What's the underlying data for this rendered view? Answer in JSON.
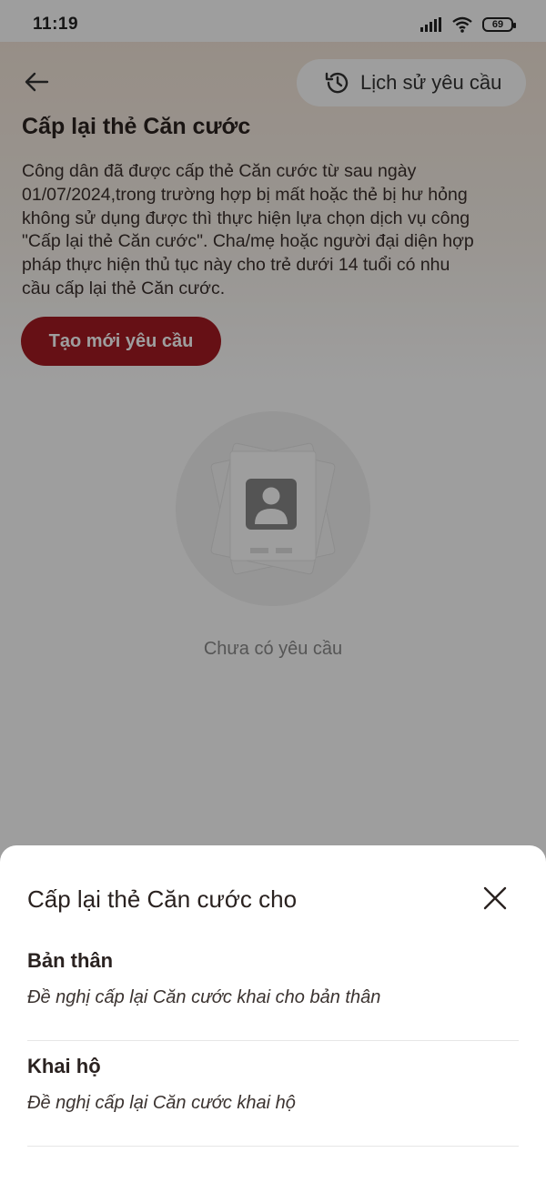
{
  "status_bar": {
    "time": "11:19",
    "battery": "69"
  },
  "header": {
    "history_label": "Lịch sử yêu cầu"
  },
  "page": {
    "title": "Cấp lại thẻ Căn cước",
    "description_lines": [
      "Công dân đã được cấp thẻ Căn cước từ sau ngày",
      "01/07/2024,trong trường hợp bị mất hoặc thẻ bị hư hỏng",
      "không sử dụng được thì thực hiện lựa chọn dịch vụ công",
      "\"Cấp lại thẻ Căn cước\". Cha/mẹ hoặc người đại diện hợp",
      "pháp thực hiện thủ tục này cho trẻ dưới 14 tuổi có nhu",
      "cầu cấp lại thẻ Căn cước."
    ],
    "create_button_label": "Tạo mới yêu cầu",
    "empty_text": "Chưa có yêu cầu"
  },
  "sheet": {
    "title": "Cấp lại thẻ Căn cước cho",
    "options": [
      {
        "title": "Bản thân",
        "description": "Đề nghị cấp lại Căn cước khai cho bản thân"
      },
      {
        "title": "Khai hộ",
        "description": "Đề nghị cấp lại Căn cước khai hộ"
      }
    ]
  },
  "colors": {
    "primary": "#a51b22",
    "overlay": "rgba(0,0,0,0.38)"
  },
  "icons": [
    "signal-icon",
    "wifi-icon",
    "battery-icon",
    "back-arrow-icon",
    "history-clock-icon",
    "id-card-icon",
    "close-icon"
  ]
}
